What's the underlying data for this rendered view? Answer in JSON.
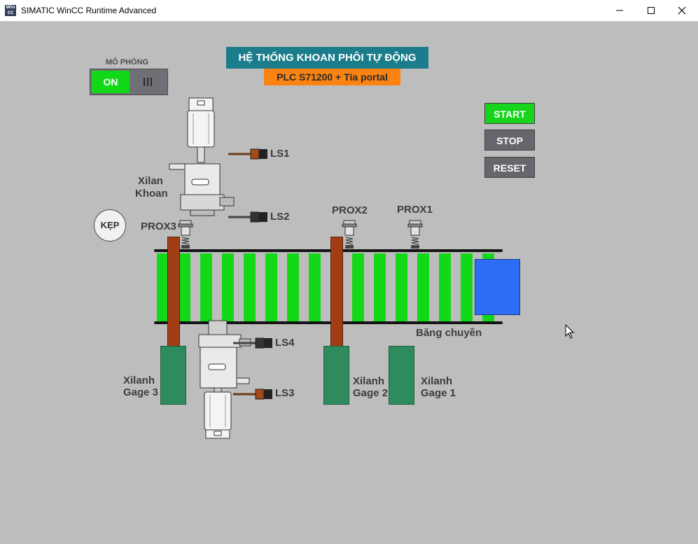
{
  "window": {
    "title": "SIMATIC WinCC Runtime Advanced",
    "icon_name": "wincc-app-icon",
    "controls": [
      "minimize-icon",
      "maximize-icon",
      "close-icon"
    ]
  },
  "simulation": {
    "label": "MÔ PHỎNG",
    "state": "ON",
    "on_color": "#12d817"
  },
  "header": {
    "title": "HỆ THỐNG KHOAN PHÔI TỰ ĐỘNG",
    "subtitle": "PLC S71200 + Tia portal",
    "title_color": "#1b7d8b",
    "subtitle_color": "#fc8211"
  },
  "controls": {
    "start": "START",
    "stop": "STOP",
    "reset": "RESET",
    "start_color": "#17d41c",
    "idle_color": "#66676c"
  },
  "clamp_button": "KẸP",
  "drill": {
    "label_line1": "Xilan",
    "label_line2": "Khoan"
  },
  "limit_switches": {
    "ls1": "LS1",
    "ls2": "LS2",
    "ls3": "LS3",
    "ls4": "LS4"
  },
  "prox_sensors": {
    "prox1": "PROX1",
    "prox2": "PROX2",
    "prox3": "PROX3"
  },
  "conveyor": {
    "label": "Băng chuyền",
    "slat_color": "#12d817"
  },
  "gages": {
    "gage1": {
      "line1": "Xilanh",
      "line2": "Gage 1"
    },
    "gage2": {
      "line1": "Xilanh",
      "line2": "Gage 2"
    },
    "gage3": {
      "line1": "Xilanh",
      "line2": "Gage 3"
    }
  },
  "workpiece_color": "#2e6cf5"
}
